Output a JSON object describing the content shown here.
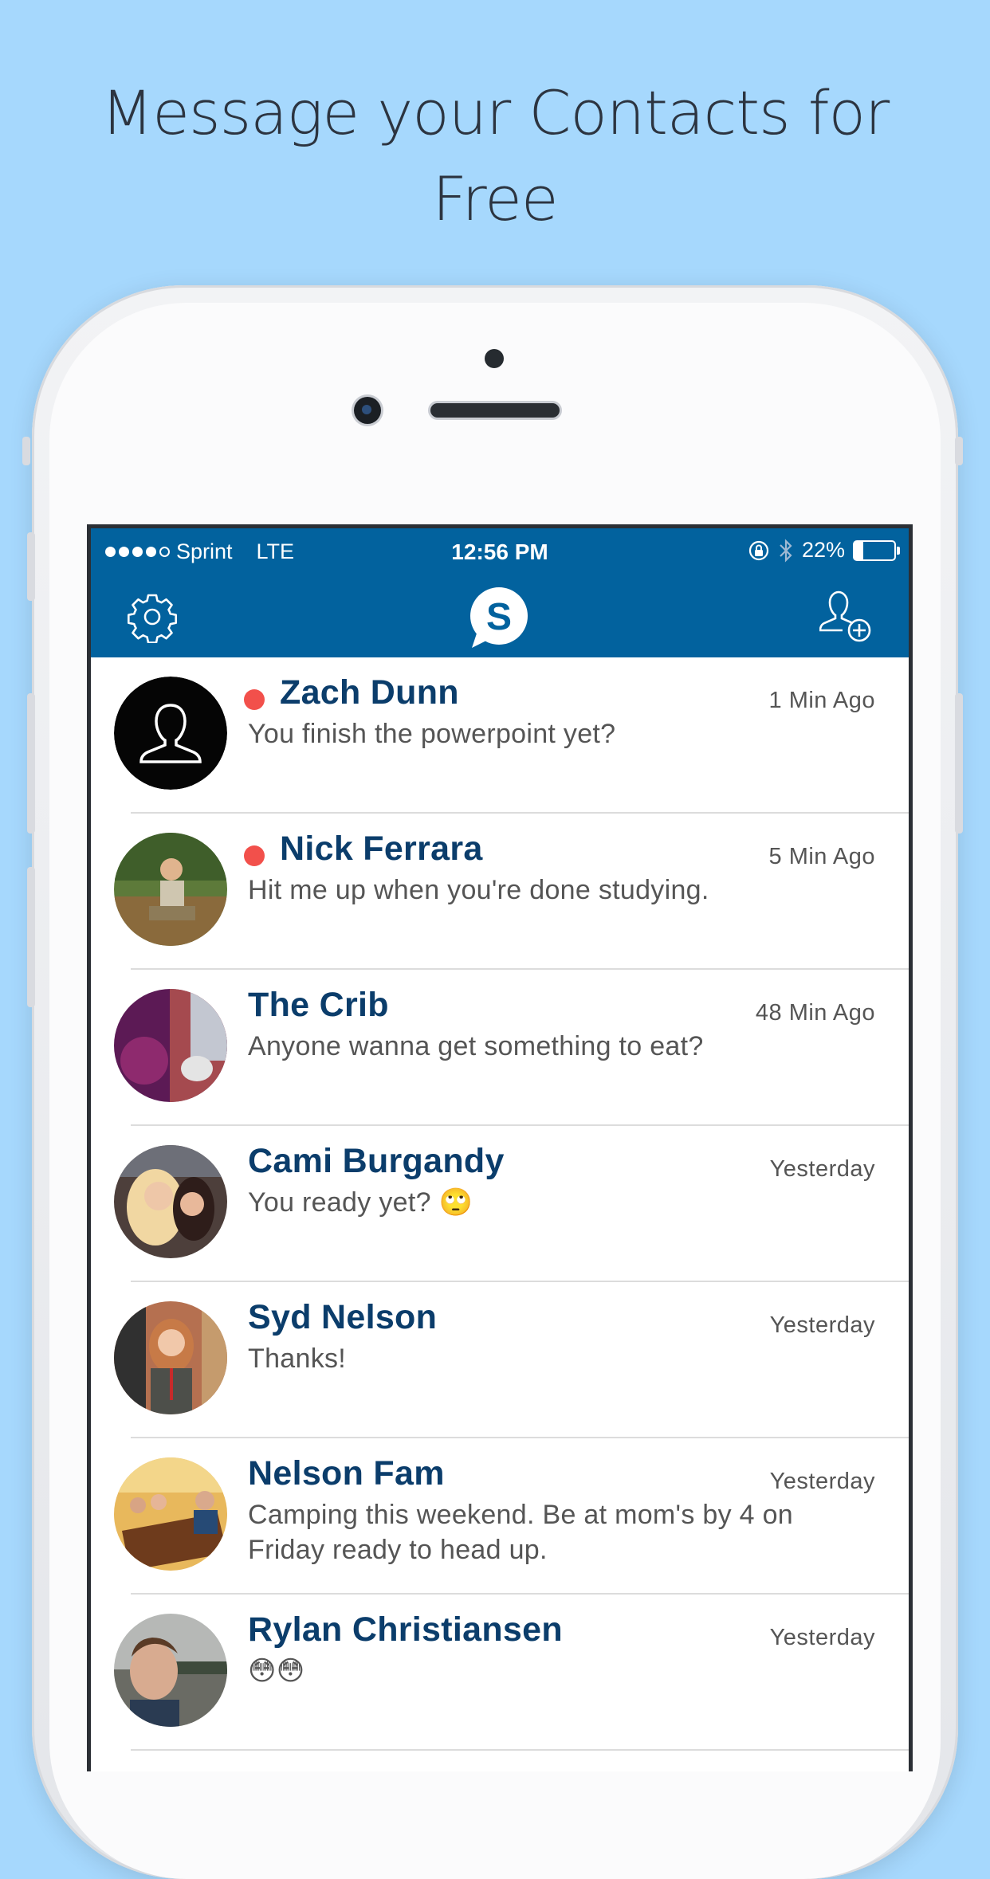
{
  "headline": {
    "line1": "Message your Contacts for",
    "line2": "Free"
  },
  "status_bar": {
    "carrier": "Sprint",
    "network": "LTE",
    "time": "12:56 PM",
    "battery": "22%",
    "battery_level": 0.22,
    "signal_bars": 4,
    "signal_max": 5
  },
  "nav": {
    "left_icon": "gear-icon",
    "center_icon": "app-logo-speech-bubble-s",
    "logo_letter": "S",
    "right_icon": "add-contact-icon"
  },
  "colors": {
    "background": "#a6d8fd",
    "nav_blue": "#02629e",
    "name_blue": "#0b3d6b",
    "unread_red": "#f2504b"
  },
  "conversations": [
    {
      "name": "Zach Dunn",
      "time": "1 Min Ago",
      "message": "You finish the powerpoint yet?",
      "unread": true
    },
    {
      "name": "Nick Ferrara",
      "time": "5 Min Ago",
      "message": "Hit me up when you're done studying.",
      "unread": true
    },
    {
      "name": "The Crib",
      "time": "48 Min Ago",
      "message": "Anyone wanna get something to eat?",
      "unread": false
    },
    {
      "name": "Cami Burgandy",
      "time": "Yesterday",
      "message": "You ready yet? 🙄",
      "unread": false
    },
    {
      "name": "Syd Nelson",
      "time": "Yesterday",
      "message": "Thanks!",
      "unread": false
    },
    {
      "name": "Nelson Fam",
      "time": "Yesterday",
      "message": "Camping this weekend. Be at mom's by 4 on Friday ready to head up.",
      "unread": false
    },
    {
      "name": "Rylan Christiansen",
      "time": "Yesterday",
      "message": "😳😳",
      "unread": false
    }
  ]
}
